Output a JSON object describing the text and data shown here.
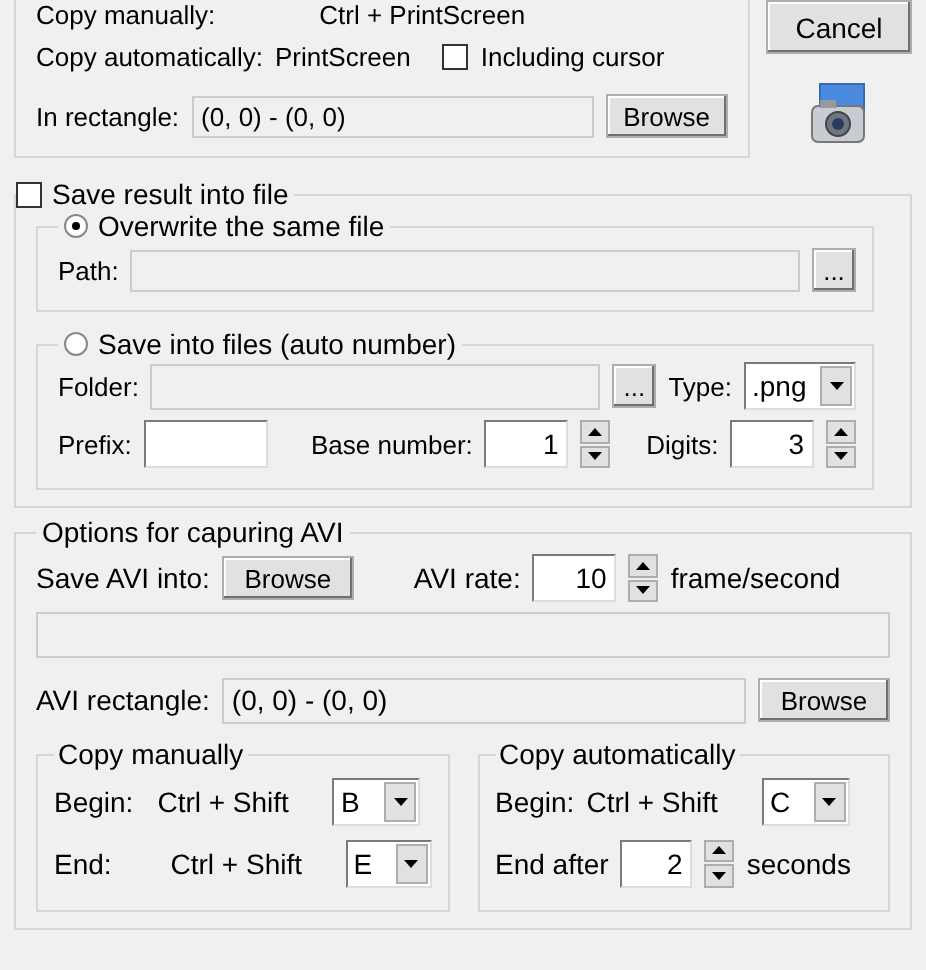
{
  "capture_group": {
    "copy_manually_label": "Copy manually:",
    "copy_manually_value": "Ctrl + PrintScreen",
    "copy_auto_label": "Copy automatically:",
    "copy_auto_value": "PrintScreen",
    "including_cursor": {
      "label": "Including cursor",
      "checked": false
    },
    "rect_label": "In rectangle:",
    "rect_value": "(0, 0) - (0, 0)",
    "browse": "Browse"
  },
  "cancel": "Cancel",
  "save_file": {
    "label": "Save result into file",
    "checked": false,
    "overwrite": {
      "label": "Overwrite the same file",
      "selected": true,
      "path_label": "Path:",
      "browse": "..."
    },
    "auto": {
      "label": "Save into files (auto number)",
      "selected": false,
      "folder_label": "Folder:",
      "browse": "...",
      "type_label": "Type:",
      "type_value": ".png",
      "prefix_label": "Prefix:",
      "base_label": "Base number:",
      "base_value": "1",
      "digits_label": "Digits:",
      "digits_value": "3"
    }
  },
  "avi": {
    "title": "Options for capuring AVI",
    "save_label": "Save AVI into:",
    "browse": "Browse",
    "rate_label": "AVI rate:",
    "rate_value": "10",
    "rate_unit": "frame/second",
    "rect_label": "AVI rectangle:",
    "rect_value": "(0, 0) - (0, 0)",
    "rect_browse": "Browse",
    "manual": {
      "title": "Copy manually",
      "rows": [
        {
          "label": "Begin:",
          "keys": "Ctrl + Shift",
          "value": "B"
        },
        {
          "label": "End:",
          "keys": "Ctrl + Shift",
          "value": "E"
        }
      ]
    },
    "automatic": {
      "title": "Copy automatically",
      "begin_label": "Begin:",
      "begin_keys": "Ctrl + Shift",
      "begin_value": "C",
      "end_label": "End after",
      "end_value": "2",
      "end_unit": "seconds"
    }
  }
}
